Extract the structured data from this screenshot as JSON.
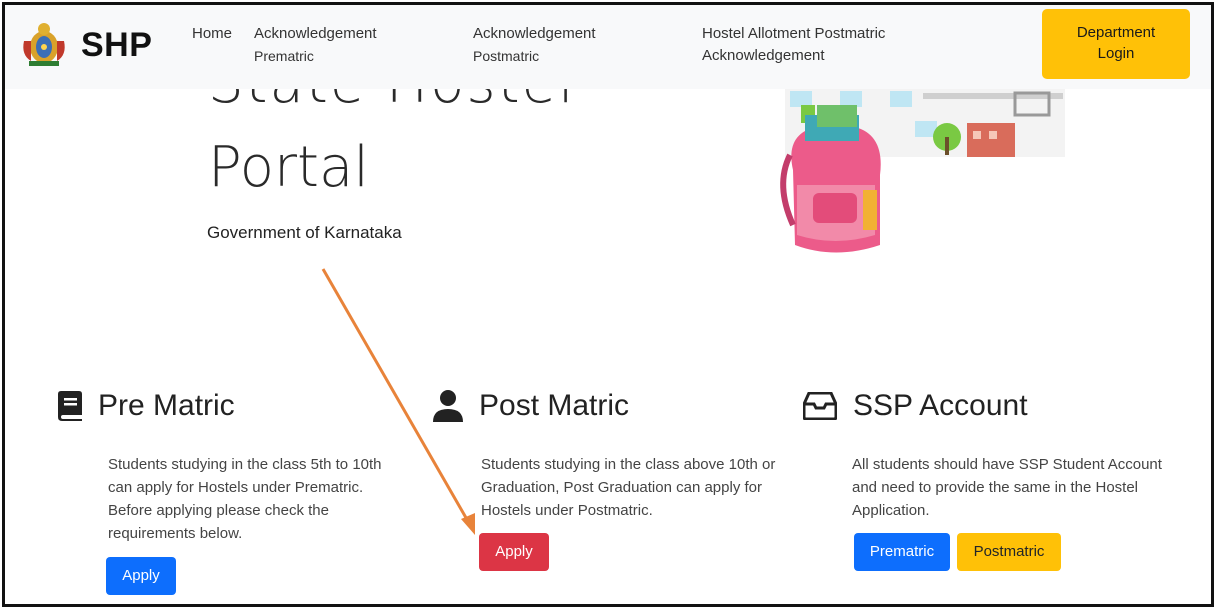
{
  "navbar": {
    "brand": "SHP",
    "links": [
      {
        "line1": "Home",
        "line2": ""
      },
      {
        "line1": "Acknowledgement",
        "line2": "Prematric"
      },
      {
        "line1": "Acknowledgement",
        "line2": "Postmatric"
      },
      {
        "line1": "Hostel Allotment Postmatric",
        "line2": "Acknowledgement"
      }
    ],
    "department_button": {
      "line1": "Department",
      "line2": "Login"
    }
  },
  "hero": {
    "title_line1": "State Hostel",
    "title_line2": "Portal",
    "subtitle": "Government of Karnataka"
  },
  "cards": [
    {
      "icon": "book-icon",
      "title": "Pre Matric",
      "description": "Students studying in the class 5th to 10th can apply for Hostels under Prematric. Before applying please check the requirements below.",
      "buttons": [
        "Apply"
      ]
    },
    {
      "icon": "user-icon",
      "title": "Post Matric",
      "description": "Students studying in the class above 10th or Graduation, Post Graduation can apply for Hostels under Postmatric.",
      "buttons": [
        "Apply"
      ]
    },
    {
      "icon": "inbox-icon",
      "title": "SSP Account",
      "description": "All students should have SSP Student Account and need to provide the same in the Hostel Application.",
      "buttons": [
        "Prematric",
        "Postmatric"
      ]
    }
  ],
  "colors": {
    "primary": "#0d6efd",
    "danger": "#dc3545",
    "warning": "#ffc107",
    "annotation_arrow": "#e8833a"
  }
}
